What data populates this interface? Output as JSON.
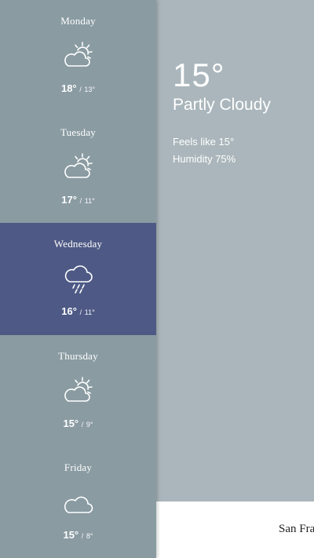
{
  "forecast": {
    "days": [
      {
        "name": "Monday",
        "icon": "partly-cloudy-icon",
        "high": "18°",
        "sep": "/",
        "low": "13°"
      },
      {
        "name": "Tuesday",
        "icon": "partly-cloudy-icon",
        "high": "17°",
        "sep": "/",
        "low": "11°"
      },
      {
        "name": "Wednesday",
        "icon": "rain-icon",
        "high": "16°",
        "sep": "/",
        "low": "11°",
        "selected": true
      },
      {
        "name": "Thursday",
        "icon": "partly-cloudy-icon",
        "high": "15°",
        "sep": "/",
        "low": "9°"
      },
      {
        "name": "Friday",
        "icon": "cloud-icon",
        "high": "15°",
        "sep": "/",
        "low": "8°"
      }
    ]
  },
  "current": {
    "temperature": "15°",
    "condition": "Partly Cloudy",
    "feels_like": "Feels like 15°",
    "humidity": "Humidity 75%"
  },
  "location": {
    "city": "San Francisco"
  },
  "colors": {
    "sidebar": "#8a9ba2",
    "selected_day": "#4e5a85",
    "main_panel": "#aab6bb",
    "city_bar": "#ffffff"
  }
}
